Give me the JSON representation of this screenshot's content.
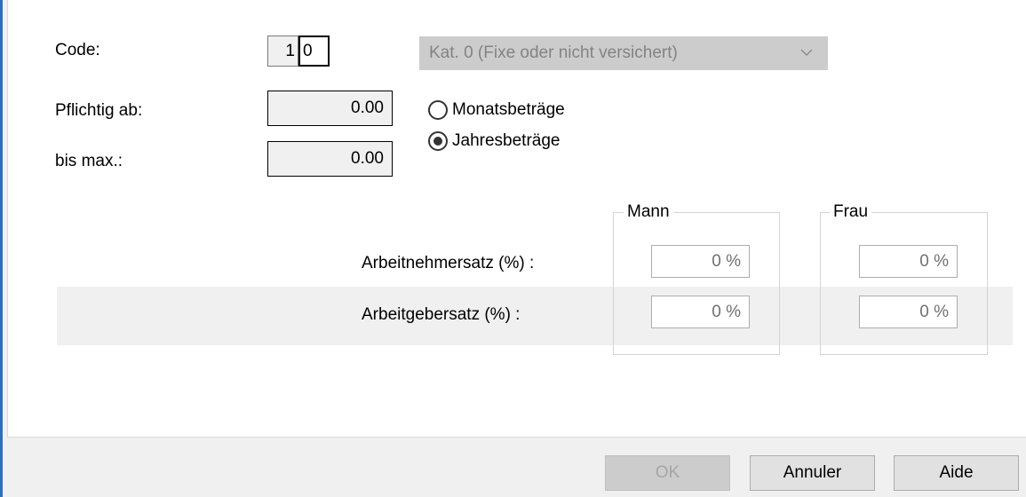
{
  "form": {
    "code_label": "Code:",
    "code_prefix": "1",
    "code_value": "0",
    "category_selected": "Kat. 0 (Fixe oder nicht versichert)",
    "pflichtig_label": "Pflichtig ab:",
    "pflichtig_value": "0.00",
    "bismax_label": "bis max.:",
    "bismax_value": "0.00",
    "radio_monthly": "Monatsbeträge",
    "radio_yearly": "Jahresbeträge",
    "radio_selected": "yearly"
  },
  "rates": {
    "group_mann": "Mann",
    "group_frau": "Frau",
    "employee_label": "Arbeitnehmersatz (%) :",
    "employer_label": "Arbeitgebersatz (%) :",
    "employee_mann": "0 %",
    "employee_frau": "0 %",
    "employer_mann": "0 %",
    "employer_frau": "0 %"
  },
  "buttons": {
    "ok": "OK",
    "cancel": "Annuler",
    "help": "Aide"
  },
  "icons": {
    "select_arrow": "chevron-down-icon"
  }
}
